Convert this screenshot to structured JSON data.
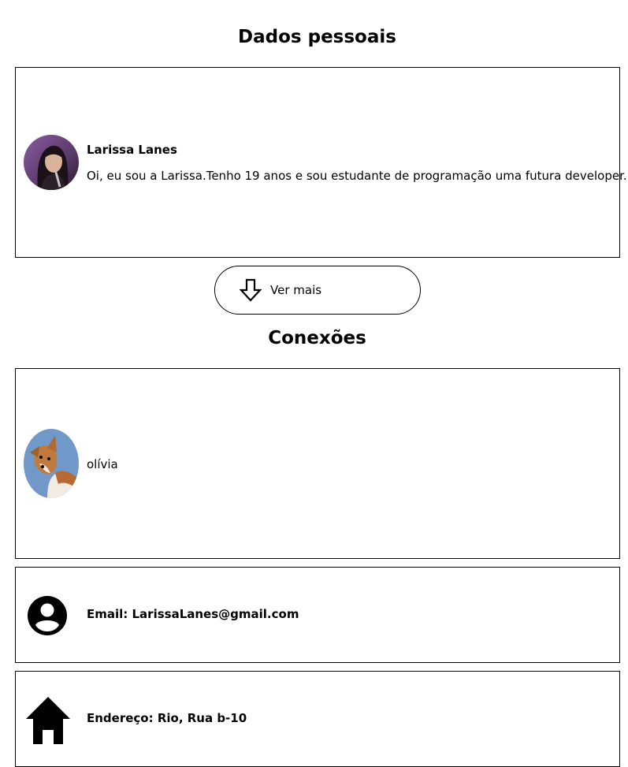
{
  "personal": {
    "heading": "Dados pessoais",
    "name": "Larissa Lanes",
    "bio": "Oi, eu sou a Larissa.Tenho 19 anos e sou estudante de programação uma futura developer."
  },
  "more_button": {
    "label": "Ver mais",
    "icon": "arrow-down-icon"
  },
  "connections": {
    "heading": "Conexões",
    "items": [
      {
        "name": "olívia"
      }
    ]
  },
  "contact": {
    "email": "Email: LarissaLanes@gmail.com",
    "email_icon": "account-circle-icon",
    "address": "Endereço: Rio, Rua b-10",
    "address_icon": "home-icon"
  },
  "colors": {
    "profile_avatar_bg": "#6a4a7a",
    "dog_avatar_bg": "#7098c8"
  }
}
